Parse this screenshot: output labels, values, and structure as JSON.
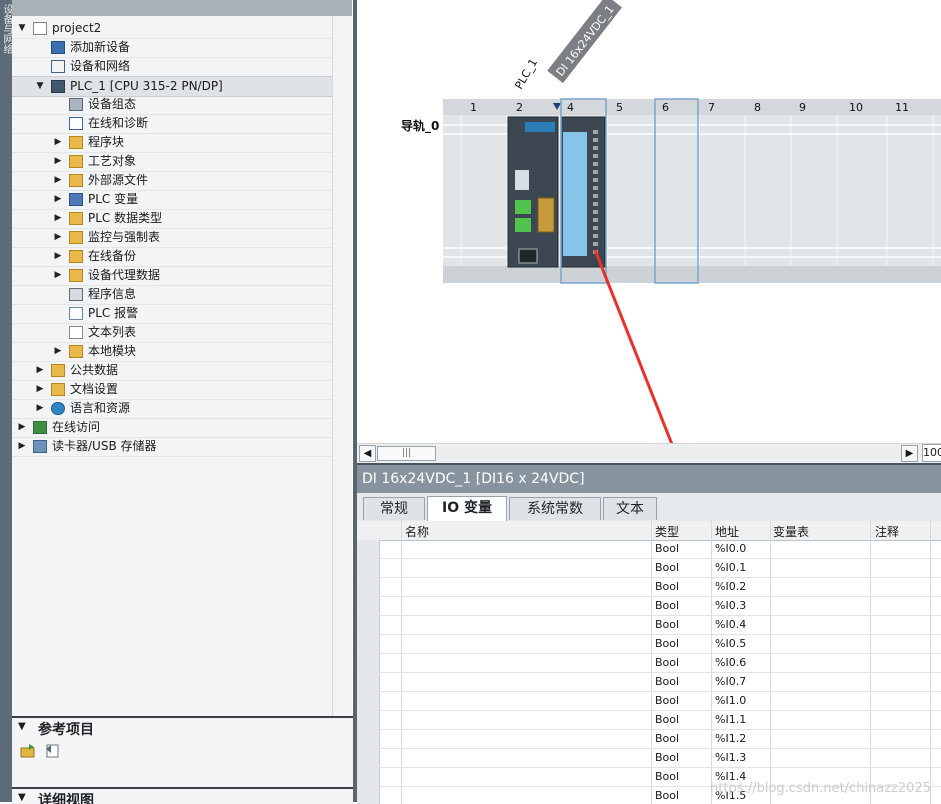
{
  "sidebar": {
    "vertical_text": "设备与网络"
  },
  "tree": {
    "items": [
      {
        "label": "project2",
        "level": 0,
        "expander": "down",
        "icon": "document-icon"
      },
      {
        "label": "添加新设备",
        "level": 1,
        "expander": "",
        "icon": "add-device-icon"
      },
      {
        "label": "设备和网络",
        "level": 1,
        "expander": "",
        "icon": "network-icon"
      },
      {
        "label": "PLC_1 [CPU 315-2 PN/DP]",
        "level": 1,
        "expander": "down",
        "icon": "plc-icon",
        "selected": true
      },
      {
        "label": "设备组态",
        "level": 2,
        "expander": "",
        "icon": "device-config-icon"
      },
      {
        "label": "在线和诊断",
        "level": 2,
        "expander": "",
        "icon": "diagnostics-icon"
      },
      {
        "label": "程序块",
        "level": 2,
        "expander": "right",
        "icon": "folder-icon"
      },
      {
        "label": "工艺对象",
        "level": 2,
        "expander": "right",
        "icon": "folder-icon"
      },
      {
        "label": "外部源文件",
        "level": 2,
        "expander": "right",
        "icon": "folder-icon"
      },
      {
        "label": "PLC 变量",
        "level": 2,
        "expander": "right",
        "icon": "tag-icon"
      },
      {
        "label": "PLC 数据类型",
        "level": 2,
        "expander": "right",
        "icon": "folder-icon"
      },
      {
        "label": "监控与强制表",
        "level": 2,
        "expander": "right",
        "icon": "folder-icon"
      },
      {
        "label": "在线备份",
        "level": 2,
        "expander": "right",
        "icon": "folder-icon"
      },
      {
        "label": "设备代理数据",
        "level": 2,
        "expander": "right",
        "icon": "folder-icon"
      },
      {
        "label": "程序信息",
        "level": 2,
        "expander": "",
        "icon": "info-icon"
      },
      {
        "label": "PLC 报警",
        "level": 2,
        "expander": "",
        "icon": "mail-icon"
      },
      {
        "label": "文本列表",
        "level": 2,
        "expander": "",
        "icon": "text-list-icon"
      },
      {
        "label": "本地模块",
        "level": 2,
        "expander": "right",
        "icon": "folder-icon"
      },
      {
        "label": "公共数据",
        "level": 1,
        "expander": "right",
        "icon": "folder-icon"
      },
      {
        "label": "文档设置",
        "level": 1,
        "expander": "right",
        "icon": "folder-icon"
      },
      {
        "label": "语言和资源",
        "level": 1,
        "expander": "right",
        "icon": "language-icon"
      },
      {
        "label": "在线访问",
        "level": 0,
        "expander": "right",
        "icon": "online-access-icon"
      },
      {
        "label": "读卡器/USB 存储器",
        "level": 0,
        "expander": "right",
        "icon": "usb-icon"
      }
    ]
  },
  "reference": {
    "title": "参考项目",
    "expander": "down"
  },
  "details": {
    "title": "详细视图",
    "expander": "down"
  },
  "device_view": {
    "plc_label": "PLC_1",
    "module_label": "DI 16x24VDC_1",
    "rail_label": "导轨_0",
    "slots": [
      "1",
      "2",
      "4",
      "5",
      "6",
      "7",
      "8",
      "9",
      "10",
      "11"
    ],
    "zoom_text": "100",
    "scroll_thumb": "|||"
  },
  "inspector": {
    "title": "DI 16x24VDC_1 [DI16 x 24VDC]",
    "tabs": [
      {
        "label": "常规",
        "active": false
      },
      {
        "label": "IO 变量",
        "active": true
      },
      {
        "label": "系统常数",
        "active": false
      },
      {
        "label": "文本",
        "active": false
      }
    ],
    "columns": {
      "name": "名称",
      "type": "类型",
      "address": "地址",
      "tag_table": "变量表",
      "comment": "注释"
    },
    "rows": [
      {
        "type": "Bool",
        "address": "%I0.0"
      },
      {
        "type": "Bool",
        "address": "%I0.1"
      },
      {
        "type": "Bool",
        "address": "%I0.2"
      },
      {
        "type": "Bool",
        "address": "%I0.3"
      },
      {
        "type": "Bool",
        "address": "%I0.4"
      },
      {
        "type": "Bool",
        "address": "%I0.5"
      },
      {
        "type": "Bool",
        "address": "%I0.6"
      },
      {
        "type": "Bool",
        "address": "%I0.7"
      },
      {
        "type": "Bool",
        "address": "%I1.0"
      },
      {
        "type": "Bool",
        "address": "%I1.1"
      },
      {
        "type": "Bool",
        "address": "%I1.2"
      },
      {
        "type": "Bool",
        "address": "%I1.3"
      },
      {
        "type": "Bool",
        "address": "%I1.4"
      },
      {
        "type": "Bool",
        "address": "%I1.5"
      }
    ]
  },
  "watermark": "https://blog.csdn.net/chinazz2025",
  "colors": {
    "accent_arrow": "#e8312a",
    "title_bar": "#8794a0",
    "selection": "#dfe3e7"
  }
}
